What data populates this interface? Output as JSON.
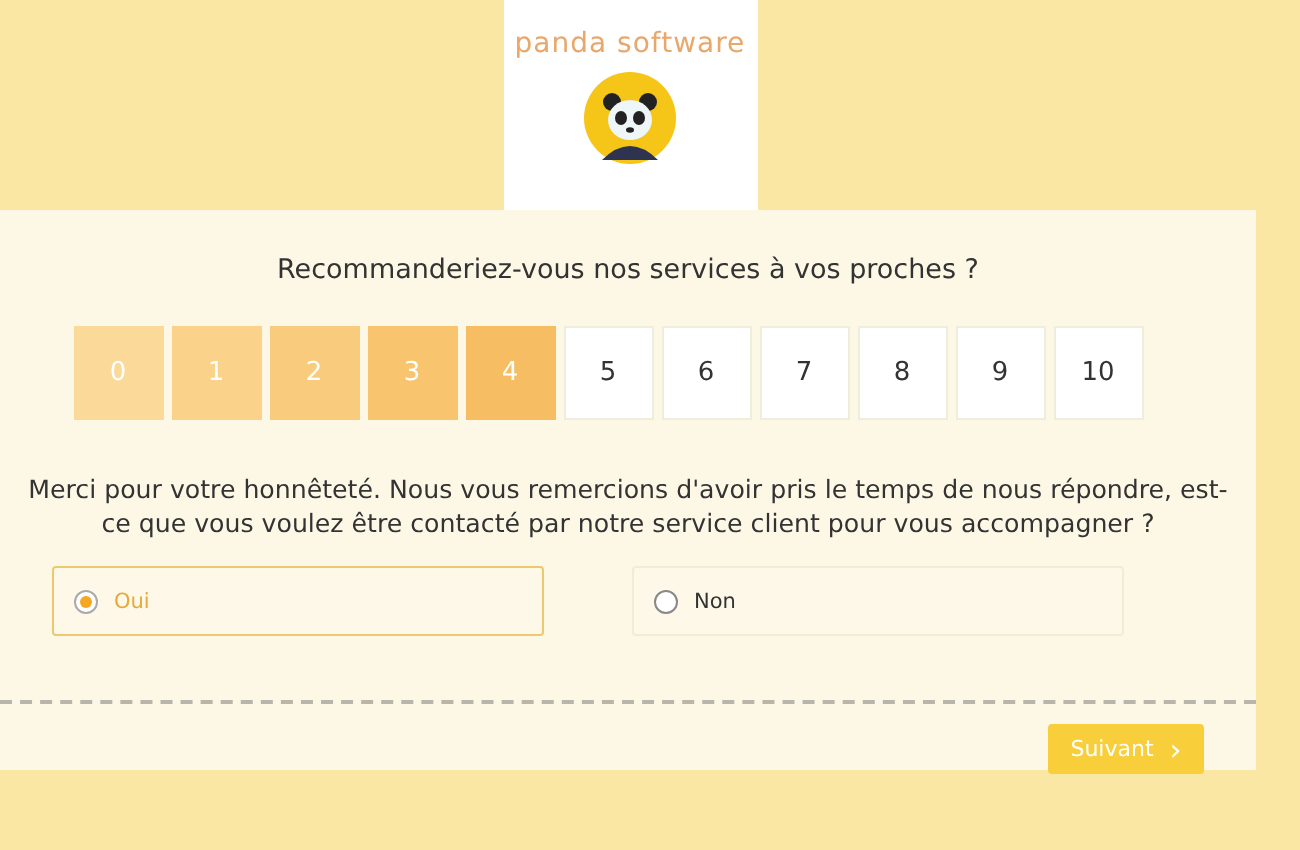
{
  "logo": {
    "brand": "panda software"
  },
  "question": "Recommanderiez-vous nos services à vos proches ?",
  "scores": [
    {
      "label": "0",
      "selected": true
    },
    {
      "label": "1",
      "selected": true
    },
    {
      "label": "2",
      "selected": true
    },
    {
      "label": "3",
      "selected": true
    },
    {
      "label": "4",
      "selected": true
    },
    {
      "label": "5",
      "selected": false
    },
    {
      "label": "6",
      "selected": false
    },
    {
      "label": "7",
      "selected": false
    },
    {
      "label": "8",
      "selected": false
    },
    {
      "label": "9",
      "selected": false
    },
    {
      "label": "10",
      "selected": false
    }
  ],
  "message": "Merci pour votre honnêteté. Nous vous remercions d'avoir pris le temps de nous répondre, est-ce que vous voulez être contacté par notre service client pour vous accompagner ?",
  "options": [
    {
      "label": "Oui",
      "selected": true
    },
    {
      "label": "Non",
      "selected": false
    }
  ],
  "next_button": {
    "label": "Suivant",
    "icon": "›"
  }
}
